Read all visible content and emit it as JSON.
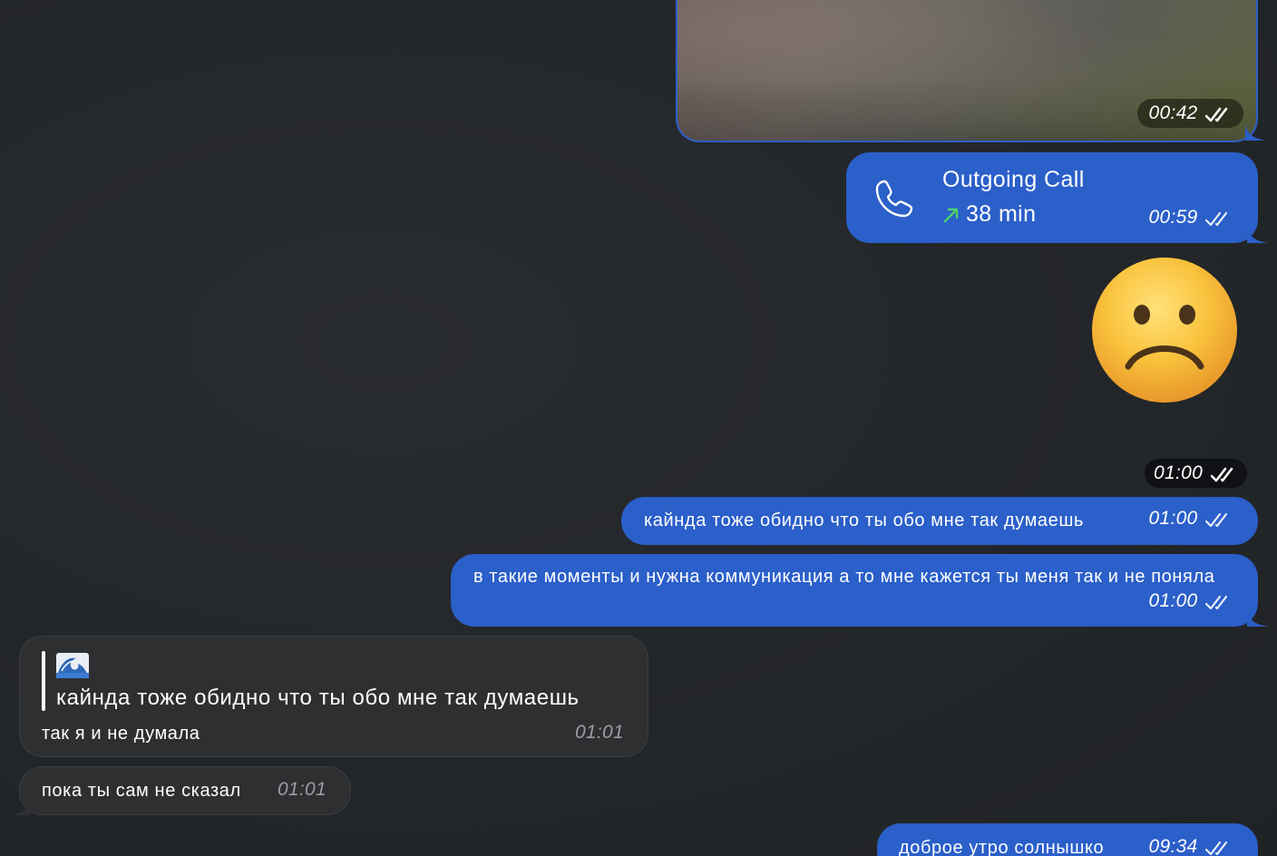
{
  "media_message": {
    "time": "00:42",
    "status": "read"
  },
  "call_message": {
    "icon": "phone-icon",
    "title": "Outgoing Call",
    "direction_icon": "outgoing-arrow-icon",
    "duration": "38 min",
    "time": "00:59",
    "status": "read"
  },
  "sticker_message": {
    "sticker": "frowning-face-sticker",
    "time": "01:00",
    "status": "read"
  },
  "messages": [
    {
      "direction": "outgoing",
      "text": "кайнда тоже обидно что ты обо мне так думаешь",
      "time": "01:00",
      "status": "read"
    },
    {
      "direction": "outgoing",
      "text": "в такие моменты и нужна коммуникация а то мне кажется ты меня так и не поняла",
      "time": "01:00",
      "status": "read"
    },
    {
      "direction": "incoming",
      "reply_to": {
        "author_emoji": "wave-emoji",
        "text": "кайнда тоже обидно что ты обо мне так думаешь"
      },
      "text": "так я и не думала",
      "time": "01:01"
    },
    {
      "direction": "incoming",
      "text": "пока ты сам не сказал",
      "time": "01:01"
    },
    {
      "direction": "outgoing",
      "text": "доброе утро солнышко",
      "time": "09:34",
      "status": "read"
    }
  ],
  "colors": {
    "background": "#24272b",
    "outgoing_bubble": "#2b5fc9",
    "incoming_bubble": "#2e2f31",
    "call_arrow": "#4fd16b",
    "incoming_time": "#9a9da2"
  }
}
